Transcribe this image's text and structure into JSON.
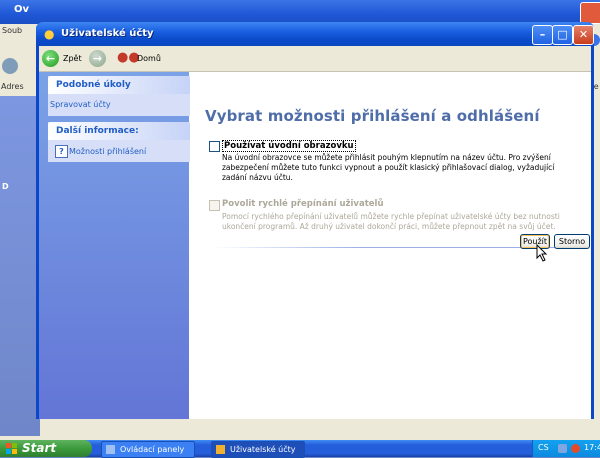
{
  "background_window": {
    "title": "Ov",
    "menu": "Soub",
    "address_label": "Adres",
    "address_right": "Pře",
    "left_label": "D"
  },
  "window": {
    "title": "Uživatelské účty",
    "toolbar": {
      "back_label": "Zpět",
      "home_label": "Domů"
    }
  },
  "taskpane": {
    "related_tasks": {
      "heading": "Podobné úkoly",
      "items": [
        "Spravovat účty"
      ]
    },
    "more_info": {
      "heading": "Další informace:",
      "items": [
        "Možnosti přihlášení"
      ]
    }
  },
  "main": {
    "heading": "Vybrat možnosti přihlášení a odhlášení",
    "option_welcome": {
      "label": "Používat úvodní obrazovku",
      "checked": false,
      "enabled": true,
      "description": "Na úvodní obrazovce se můžete přihlásit pouhým klepnutím na název účtu. Pro zvýšení zabezpečení můžete tuto funkci vypnout a použít klasický přihlašovací dialog, vyžadující zadání názvu účtu."
    },
    "option_fast_switch": {
      "label": "Povolit rychlé přepínání uživatelů",
      "checked": false,
      "enabled": false,
      "description": "Pomocí rychlého přepínání uživatelů můžete rychle přepínat uživatelské účty bez nutnosti ukončení programů. Až druhý uživatel dokončí práci, můžete přepnout zpět na svůj účet."
    },
    "buttons": {
      "apply": "Použít",
      "cancel": "Storno"
    }
  },
  "taskbar": {
    "start_label": "Start",
    "tasks": [
      "Ovládací panely",
      "Uživatelské účty"
    ],
    "language": "CS",
    "clock": "17:4"
  },
  "colors": {
    "titlebar": "#0a48c2",
    "heading": "#4f6da8",
    "taskpane": "#6375d6",
    "link": "#215dc6"
  }
}
